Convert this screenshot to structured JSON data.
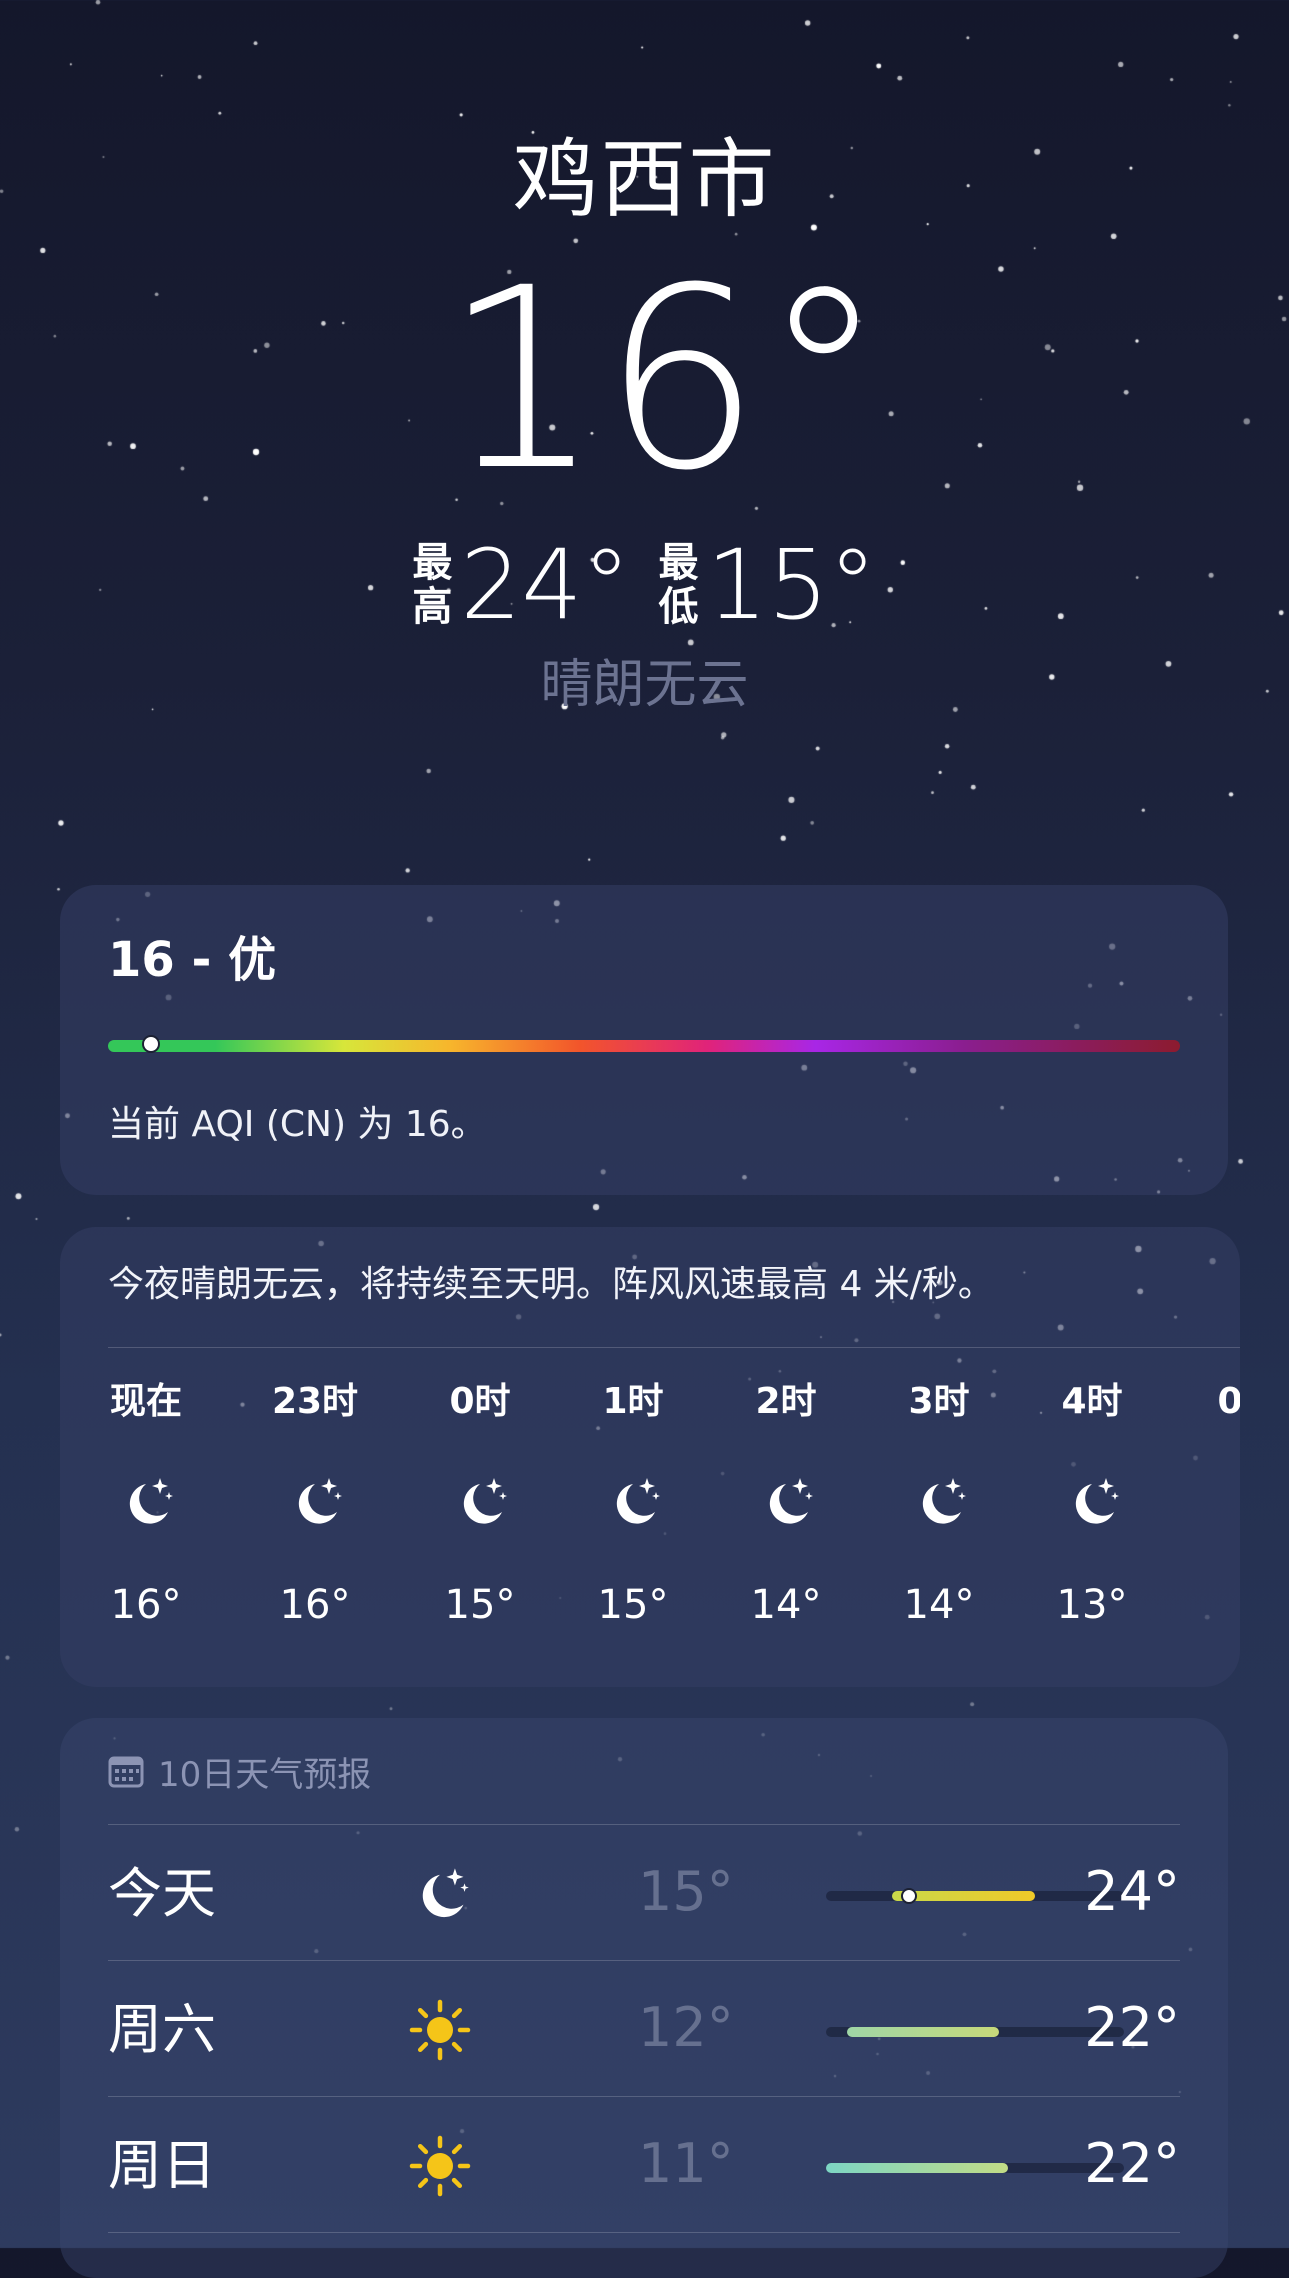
{
  "header": {
    "city": "鸡西市",
    "current_temp": "16°",
    "high_label_1": "最",
    "high_label_2": "高",
    "high_value": "24°",
    "low_label_1": "最",
    "low_label_2": "低",
    "low_value": "15°",
    "condition": "晴朗无云"
  },
  "aqi": {
    "title": "16 - 优",
    "level_fraction": 0.04,
    "description": "当前 AQI (CN) 为 16。"
  },
  "hourly": {
    "summary": "今夜晴朗无云，将持续至天明。阵风风速最高 4 米/秒。",
    "items": [
      {
        "time": "现在",
        "icon": "moon-stars-icon",
        "temp": "16°"
      },
      {
        "time": "23时",
        "icon": "moon-stars-icon",
        "temp": "16°"
      },
      {
        "time": "0时",
        "icon": "moon-stars-icon",
        "temp": "15°"
      },
      {
        "time": "1时",
        "icon": "moon-stars-icon",
        "temp": "15°"
      },
      {
        "time": "2时",
        "icon": "moon-stars-icon",
        "temp": "14°"
      },
      {
        "time": "3时",
        "icon": "moon-stars-icon",
        "temp": "14°"
      },
      {
        "time": "4时",
        "icon": "moon-stars-icon",
        "temp": "13°"
      },
      {
        "time": "0",
        "icon": "",
        "temp": ""
      }
    ]
  },
  "daily": {
    "title": "10日天气预报",
    "items": [
      {
        "day": "今天",
        "icon": "moon-stars-icon",
        "low": "15°",
        "high": "24°",
        "range_start": 0.22,
        "range_end": 0.7,
        "now": 0.28,
        "color_from": "#c9d94a",
        "color_to": "#f0c928"
      },
      {
        "day": "周六",
        "icon": "sun-icon",
        "low": "12°",
        "high": "22°",
        "range_start": 0.07,
        "range_end": 0.58,
        "now": null,
        "color_from": "#9fd6a6",
        "color_to": "#c7d97a"
      },
      {
        "day": "周日",
        "icon": "sun-icon",
        "low": "11°",
        "high": "22°",
        "range_start": 0.0,
        "range_end": 0.61,
        "now": null,
        "color_from": "#7dd6c4",
        "color_to": "#c2dc86"
      }
    ]
  },
  "colors": {
    "background_top": "#14172b",
    "background_bottom": "#2e3b5f",
    "condition_text": "#6c7391",
    "low_temp_text": "#66708f",
    "sun": "#f5c518"
  }
}
